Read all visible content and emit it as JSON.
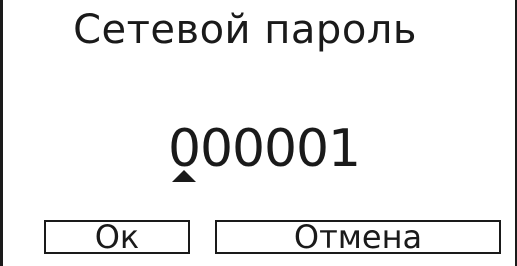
{
  "dialog": {
    "title": "Сетевой пароль",
    "pin_digits": [
      "0",
      "0",
      "0",
      "0",
      "0",
      "1"
    ],
    "cursor_position": 1,
    "ok_label": "Ок",
    "cancel_label": "Отмена"
  }
}
